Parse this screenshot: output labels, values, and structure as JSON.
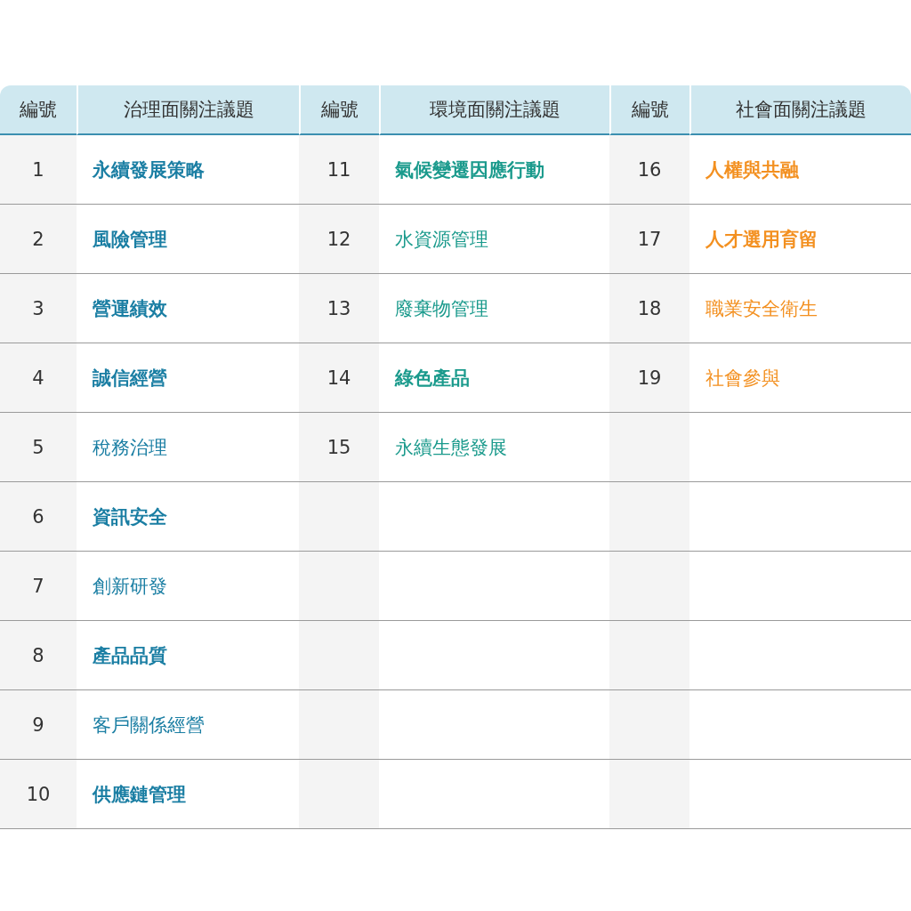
{
  "table": {
    "headers": [
      "編號",
      "治理面關注議題",
      "編號",
      "環境面關注議題",
      "編號",
      "社會面關注議題"
    ],
    "groups": [
      {
        "color": "#1a7ea3",
        "items": [
          {
            "number": "1",
            "topic": "永續發展策略",
            "highlighted": true
          },
          {
            "number": "2",
            "topic": "風險管理",
            "highlighted": true
          },
          {
            "number": "3",
            "topic": "營運績效",
            "highlighted": true
          },
          {
            "number": "4",
            "topic": "誠信經營",
            "highlighted": true
          },
          {
            "number": "5",
            "topic": "稅務治理",
            "highlighted": false
          },
          {
            "number": "6",
            "topic": "資訊安全",
            "highlighted": true
          },
          {
            "number": "7",
            "topic": "創新研發",
            "highlighted": false
          },
          {
            "number": "8",
            "topic": "產品品質",
            "highlighted": true
          },
          {
            "number": "9",
            "topic": "客戶關係經營",
            "highlighted": false
          },
          {
            "number": "10",
            "topic": "供應鏈管理",
            "highlighted": true
          }
        ]
      },
      {
        "color": "#1a9a8c",
        "items": [
          {
            "number": "11",
            "topic": "氣候變遷因應行動",
            "highlighted": true
          },
          {
            "number": "12",
            "topic": "水資源管理",
            "highlighted": false
          },
          {
            "number": "13",
            "topic": "廢棄物管理",
            "highlighted": false
          },
          {
            "number": "14",
            "topic": "綠色產品",
            "highlighted": true
          },
          {
            "number": "15",
            "topic": "永續生態發展",
            "highlighted": false
          }
        ]
      },
      {
        "color": "#f39020",
        "items": [
          {
            "number": "16",
            "topic": "人權與共融",
            "highlighted": true
          },
          {
            "number": "17",
            "topic": "人才選用育留",
            "highlighted": true
          },
          {
            "number": "18",
            "topic": "職業安全衛生",
            "highlighted": false
          },
          {
            "number": "19",
            "topic": "社會參與",
            "highlighted": false
          }
        ]
      }
    ]
  }
}
